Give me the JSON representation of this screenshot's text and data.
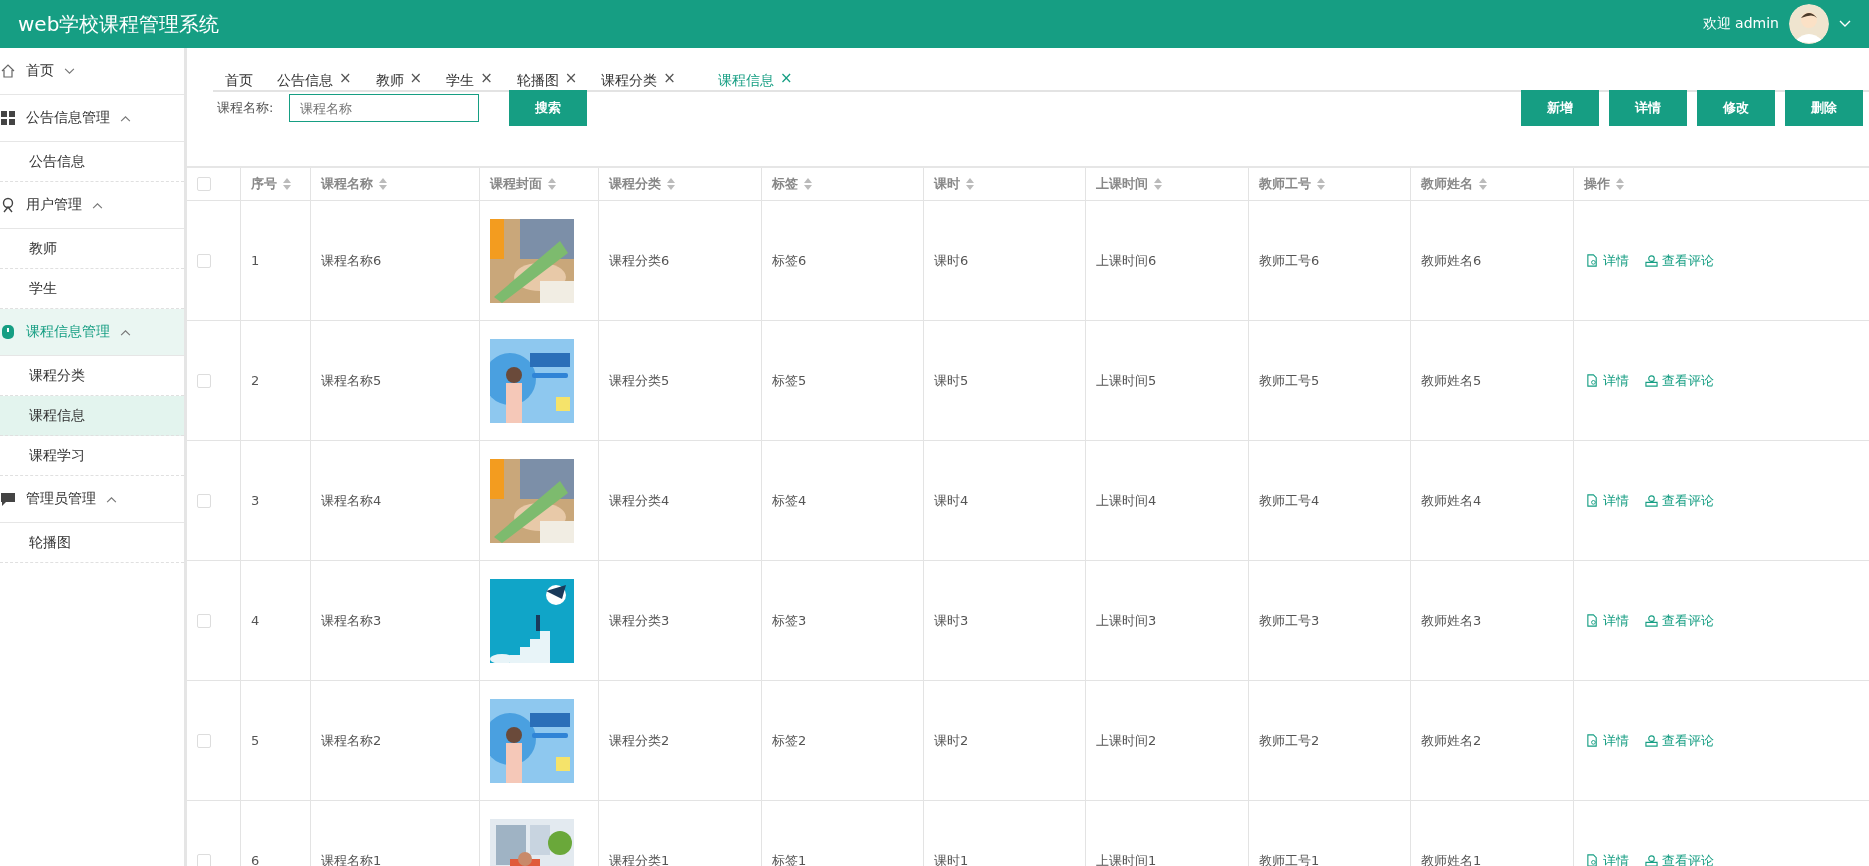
{
  "header": {
    "title": "web学校课程管理系统",
    "welcome": "欢迎 admin"
  },
  "sidebar": {
    "items": [
      {
        "label": "首页",
        "expanded": false,
        "selected": false
      },
      {
        "label": "公告信息管理",
        "expanded": true,
        "selected": false,
        "children": [
          {
            "label": "公告信息",
            "selected": false
          }
        ]
      },
      {
        "label": "用户管理",
        "expanded": true,
        "selected": false,
        "children": [
          {
            "label": "教师",
            "selected": false
          },
          {
            "label": "学生",
            "selected": false
          }
        ]
      },
      {
        "label": "课程信息管理",
        "expanded": true,
        "selected": true,
        "children": [
          {
            "label": "课程分类",
            "selected": false
          },
          {
            "label": "课程信息",
            "selected": true
          },
          {
            "label": "课程学习",
            "selected": false
          }
        ]
      },
      {
        "label": "管理员管理",
        "expanded": true,
        "selected": false,
        "children": [
          {
            "label": "轮播图",
            "selected": false
          }
        ]
      }
    ]
  },
  "tabs": [
    {
      "label": "首页",
      "closable": false,
      "selected": false
    },
    {
      "label": "公告信息",
      "closable": true,
      "selected": false
    },
    {
      "label": "教师",
      "closable": true,
      "selected": false
    },
    {
      "label": "学生",
      "closable": true,
      "selected": false
    },
    {
      "label": "轮播图",
      "closable": true,
      "selected": false
    },
    {
      "label": "课程分类",
      "closable": true,
      "selected": false
    },
    {
      "label": "课程信息",
      "closable": true,
      "selected": true
    }
  ],
  "close_glyph": "×",
  "search": {
    "label": "课程名称:",
    "placeholder": "课程名称",
    "button": "搜索"
  },
  "actions": [
    "新增",
    "详情",
    "修改",
    "删除"
  ],
  "table": {
    "all_checked": false,
    "columns": [
      "序号",
      "课程名称",
      "课程封面",
      "课程分类",
      "标签",
      "课时",
      "上课时间",
      "教师工号",
      "教师姓名",
      "操作"
    ],
    "rows": [
      {
        "checked": false,
        "cells": [
          "1",
          "课程名称6",
          {
            "kind": "picture"
          },
          "课程分类6",
          "标签6",
          "课时6",
          "上课时间6",
          "教师工号6",
          "教师姓名6"
        ],
        "links": [
          "详情",
          "查看评论"
        ]
      },
      {
        "checked": false,
        "cells": [
          "2",
          "课程名称5",
          {
            "kind": "picture"
          },
          "课程分类5",
          "标签5",
          "课时5",
          "上课时间5",
          "教师工号5",
          "教师姓名5"
        ],
        "links": [
          "详情",
          "查看评论"
        ]
      },
      {
        "checked": false,
        "cells": [
          "3",
          "课程名称4",
          {
            "kind": "picture"
          },
          "课程分类4",
          "标签4",
          "课时4",
          "上课时间4",
          "教师工号4",
          "教师姓名4"
        ],
        "links": [
          "详情",
          "查看评论"
        ]
      },
      {
        "checked": false,
        "cells": [
          "4",
          "课程名称3",
          {
            "kind": "picture"
          },
          "课程分类3",
          "标签3",
          "课时3",
          "上课时间3",
          "教师工号3",
          "教师姓名3"
        ],
        "links": [
          "详情",
          "查看评论"
        ]
      },
      {
        "checked": false,
        "cells": [
          "5",
          "课程名称2",
          {
            "kind": "picture"
          },
          "课程分类2",
          "标签2",
          "课时2",
          "上课时间2",
          "教师工号2",
          "教师姓名2"
        ],
        "links": [
          "详情",
          "查看评论"
        ]
      },
      {
        "checked": false,
        "cells": [
          "6",
          "课程名称1",
          {
            "kind": "picture"
          },
          "课程分类1",
          "标签1",
          "课时1",
          "上课时间1",
          "教师工号1",
          "教师姓名1"
        ],
        "links": [
          "详情",
          "查看评论"
        ]
      }
    ]
  }
}
